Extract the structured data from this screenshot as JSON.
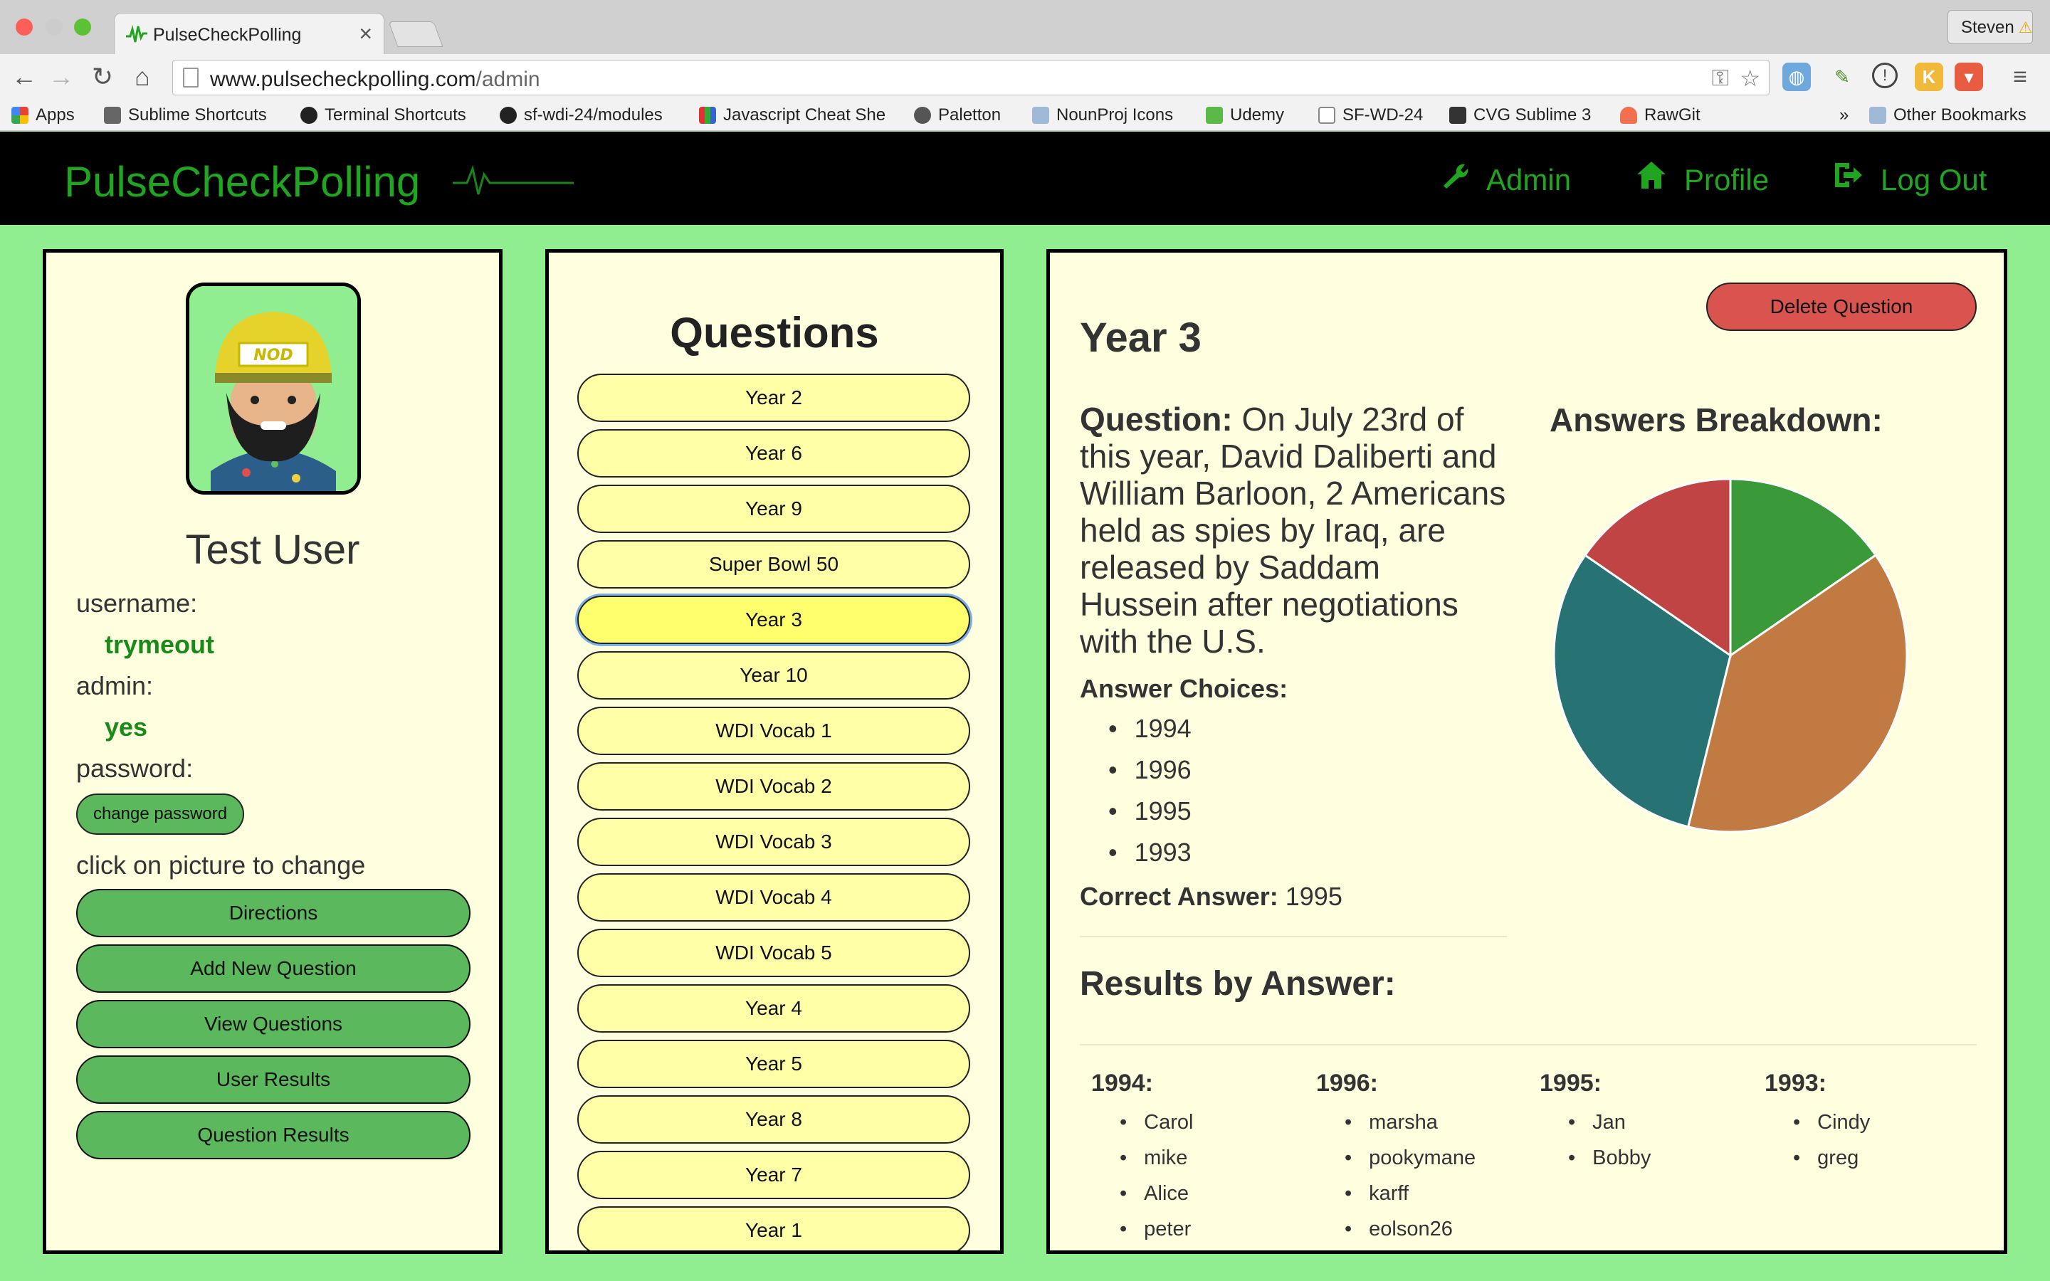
{
  "browser": {
    "tab_title": "PulseCheckPolling",
    "user": "Steven",
    "url_host": "www.pulsecheckpolling.com",
    "url_path": "/admin",
    "bookmarks": [
      {
        "label": "Apps",
        "icon": "apps-grid-icon"
      },
      {
        "label": "Sublime Shortcuts",
        "icon": "doc-icon"
      },
      {
        "label": "Terminal Shortcuts",
        "icon": "github-icon"
      },
      {
        "label": "sf-wdi-24/modules",
        "icon": "github-icon"
      },
      {
        "label": "Javascript Cheat She",
        "icon": "cheatsheet-icon"
      },
      {
        "label": "Paletton",
        "icon": "paletton-icon"
      },
      {
        "label": "NounProj Icons",
        "icon": "folder-icon"
      },
      {
        "label": "Udemy",
        "icon": "udemy-icon"
      },
      {
        "label": "SF-WD-24",
        "icon": "page-icon"
      },
      {
        "label": "CVG Sublime 3",
        "icon": "sublime-icon"
      },
      {
        "label": "RawGit",
        "icon": "rawgit-icon"
      }
    ],
    "overflow": "»",
    "other_bookmarks": "Other Bookmarks"
  },
  "header": {
    "brand": "PulseCheckPolling",
    "nav": [
      {
        "label": "Admin",
        "icon": "wrench-icon"
      },
      {
        "label": "Profile",
        "icon": "home-icon"
      },
      {
        "label": "Log Out",
        "icon": "logout-icon"
      }
    ]
  },
  "profile": {
    "avatar_text": "NOD",
    "name": "Test User",
    "username_label": "username:",
    "username": "trymeout",
    "admin_label": "admin:",
    "admin": "yes",
    "password_label": "password:",
    "change_password": "change password",
    "picture_hint": "click on picture to change",
    "buttons": [
      "Directions",
      "Add New Question",
      "View Questions",
      "User Results",
      "Question Results"
    ]
  },
  "questions": {
    "title": "Questions",
    "items": [
      "Year 2",
      "Year 6",
      "Year 9",
      "Super Bowl 50",
      "Year 3",
      "Year 10",
      "WDI Vocab 1",
      "WDI Vocab 2",
      "WDI Vocab 3",
      "WDI Vocab 4",
      "WDI Vocab 5",
      "Year 4",
      "Year 5",
      "Year 8",
      "Year 7",
      "Year 1"
    ],
    "selected": "Year 3"
  },
  "detail": {
    "delete_label": "Delete Question",
    "title": "Year 3",
    "question_label": "Question:",
    "question_text": "On July 23rd of this year, David Daliberti and William Barloon, 2 Americans held as spies by Iraq, are released by Saddam Hussein after negotiations with the U.S.",
    "choices_label": "Answer Choices:",
    "choices": [
      "1994",
      "1996",
      "1995",
      "1993"
    ],
    "correct_label": "Correct Answer:",
    "correct_answer": "1995",
    "breakdown_title": "Answers Breakdown:",
    "results_title": "Results by Answer:",
    "results": [
      {
        "answer": "1994:",
        "voters": [
          "Carol",
          "mike",
          "Alice",
          "peter"
        ]
      },
      {
        "answer": "1996:",
        "voters": [
          "marsha",
          "pookymane",
          "karff",
          "eolson26"
        ]
      },
      {
        "answer": "1995:",
        "voters": [
          "Jan",
          "Bobby"
        ]
      },
      {
        "answer": "1993:",
        "voters": [
          "Cindy",
          "greg"
        ]
      }
    ]
  },
  "chart_data": {
    "type": "pie",
    "slices": [
      {
        "value": 2,
        "color": "#3a9a3a"
      },
      {
        "value": 5,
        "color": "#c07a42"
      },
      {
        "value": 4,
        "color": "#277272"
      },
      {
        "value": 2,
        "color": "#c04444"
      }
    ]
  },
  "colors": {
    "page_bg": "#90ee90",
    "panel_bg": "#ffffe0",
    "brand_green": "#1fa51f",
    "button_green": "#5cb85c",
    "question_yellow": "#ffffa8",
    "delete_red": "#d9534f"
  }
}
